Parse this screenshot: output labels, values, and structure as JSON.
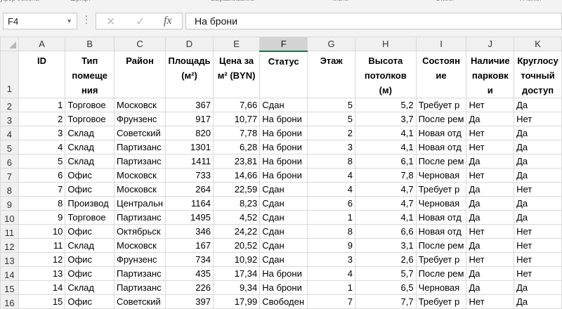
{
  "ribbon_cut": [
    {
      "text": "уфер обмена"
    },
    {
      "text": "Шрифт"
    },
    {
      "text": "Выравнивание"
    },
    {
      "text": "Число"
    },
    {
      "text": "Стили"
    },
    {
      "text": "Ячейки"
    }
  ],
  "formula_bar": {
    "cell_ref": "F4",
    "dropdown_icon": "chevron-down-icon",
    "cancel_icon": "close-icon",
    "enter_icon": "check-icon",
    "function_label": "fx",
    "content": "На брони"
  },
  "columns": [
    "A",
    "B",
    "C",
    "D",
    "E",
    "F",
    "G",
    "H",
    "I",
    "J",
    "K"
  ],
  "active_column": "F",
  "header_row": {
    "row_number": "1",
    "cells": [
      [
        "ID"
      ],
      [
        "Тип",
        "помеще",
        "ния"
      ],
      [
        "Район"
      ],
      [
        "Площадь",
        "(м²)"
      ],
      [
        "Цена за",
        "м² (BYN)"
      ],
      [
        "Статус"
      ],
      [
        "Этаж"
      ],
      [
        "Высота",
        "потолков",
        "(м)"
      ],
      [
        "Состоян",
        "ие"
      ],
      [
        "Наличие",
        "парковк",
        "и"
      ],
      [
        "Круглосу",
        "точный",
        "доступ"
      ]
    ]
  },
  "rows": [
    {
      "n": "2",
      "cells": [
        "1",
        "Торговое",
        "Московск",
        "367",
        "7,66",
        "Сдан",
        "5",
        "5,2",
        "Требует р",
        "Нет",
        "Да"
      ]
    },
    {
      "n": "3",
      "cells": [
        "2",
        "Торговое",
        "Фрунзенс",
        "917",
        "10,77",
        "На брони",
        "5",
        "3,7",
        "После рем",
        "Да",
        "Нет"
      ]
    },
    {
      "n": "4",
      "cells": [
        "3",
        "Склад",
        "Советский",
        "820",
        "7,78",
        "На брони",
        "2",
        "4,1",
        "Новая отд",
        "Нет",
        "Да"
      ]
    },
    {
      "n": "5",
      "cells": [
        "4",
        "Склад",
        "Партизанс",
        "1301",
        "6,28",
        "На брони",
        "3",
        "4,1",
        "Новая отд",
        "Нет",
        "Да"
      ]
    },
    {
      "n": "6",
      "cells": [
        "5",
        "Склад",
        "Партизанс",
        "1411",
        "23,81",
        "На брони",
        "8",
        "6,1",
        "После рем",
        "Да",
        "Да"
      ]
    },
    {
      "n": "7",
      "cells": [
        "6",
        "Офис",
        "Московск",
        "733",
        "14,66",
        "На брони",
        "4",
        "7,8",
        "Черновая",
        "Нет",
        "Да"
      ]
    },
    {
      "n": "8",
      "cells": [
        "7",
        "Офис",
        "Московск",
        "264",
        "22,59",
        "Сдан",
        "4",
        "4,7",
        "Требует р",
        "Да",
        "Нет"
      ]
    },
    {
      "n": "9",
      "cells": [
        "8",
        "Производ",
        "Центральн",
        "1164",
        "8,23",
        "Сдан",
        "6",
        "4,7",
        "Черновая",
        "Да",
        "Да"
      ]
    },
    {
      "n": "10",
      "cells": [
        "9",
        "Торговое",
        "Партизанс",
        "1495",
        "4,52",
        "Сдан",
        "1",
        "4,1",
        "Новая отд",
        "Да",
        "Да"
      ]
    },
    {
      "n": "11",
      "cells": [
        "10",
        "Офис",
        "Октябрьск",
        "346",
        "24,22",
        "Сдан",
        "8",
        "6,6",
        "Новая отд",
        "Нет",
        "Нет"
      ]
    },
    {
      "n": "12",
      "cells": [
        "11",
        "Склад",
        "Московск",
        "167",
        "20,52",
        "Сдан",
        "9",
        "3,1",
        "После рем",
        "Да",
        "Нет"
      ]
    },
    {
      "n": "13",
      "cells": [
        "12",
        "Офис",
        "Фрунзенс",
        "734",
        "10,92",
        "Сдан",
        "3",
        "2,6",
        "Требует р",
        "Нет",
        "Нет"
      ]
    },
    {
      "n": "14",
      "cells": [
        "13",
        "Офис",
        "Партизанс",
        "435",
        "17,34",
        "На брони",
        "4",
        "5,7",
        "После рем",
        "Да",
        "Нет"
      ]
    },
    {
      "n": "15",
      "cells": [
        "14",
        "Склад",
        "Партизанс",
        "226",
        "9,34",
        "На брони",
        "1",
        "6,5",
        "Черновая",
        "Да",
        "Да"
      ]
    },
    {
      "n": "16",
      "cells": [
        "15",
        "Офис",
        "Советский",
        "397",
        "17,99",
        "Свободен",
        "7",
        "7,7",
        "Требует р",
        "Нет",
        "Да"
      ]
    }
  ]
}
